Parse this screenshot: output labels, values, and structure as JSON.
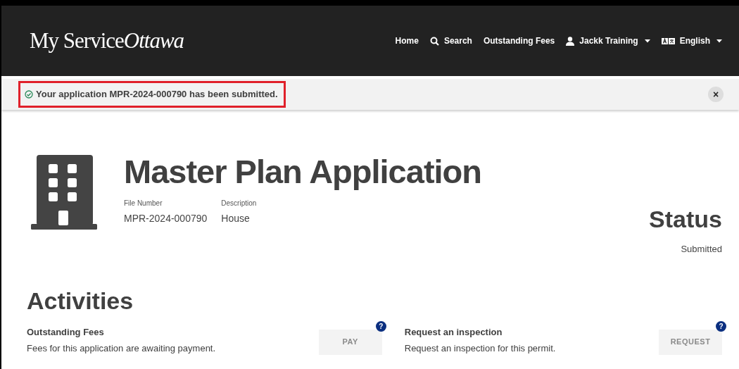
{
  "header": {
    "logo_text": "My Service",
    "logo_text_2": "Ottawa",
    "nav": [
      {
        "label": "Home",
        "kind": "plain",
        "dropdown": false
      },
      {
        "label": "Search",
        "kind": "search",
        "dropdown": false
      },
      {
        "label": "Outstanding Fees",
        "kind": "plain",
        "dropdown": false
      },
      {
        "label": "Jackk Training",
        "kind": "user",
        "dropdown": true
      },
      {
        "label": "English",
        "kind": "language",
        "dropdown": true
      }
    ]
  },
  "alert": {
    "message": "Your application MPR-2024-000790 has been submitted.",
    "highlighted": true,
    "close_label": "×"
  },
  "application": {
    "title": "Master Plan Application",
    "fields": [
      {
        "label": "File Number",
        "value": "MPR-2024-000790"
      },
      {
        "label": "Description",
        "value": "House"
      }
    ],
    "status_heading": "Status",
    "status_value": "Submitted"
  },
  "activities": {
    "heading": "Activities",
    "items": [
      {
        "title": "Outstanding Fees",
        "text": "Fees for this application are awaiting payment.",
        "button": "PAY",
        "disabled": true,
        "help": "?"
      },
      {
        "title": "Request an inspection",
        "text": "Request an inspection for this permit.",
        "button": "REQUEST",
        "disabled": true,
        "help": "?"
      }
    ]
  }
}
